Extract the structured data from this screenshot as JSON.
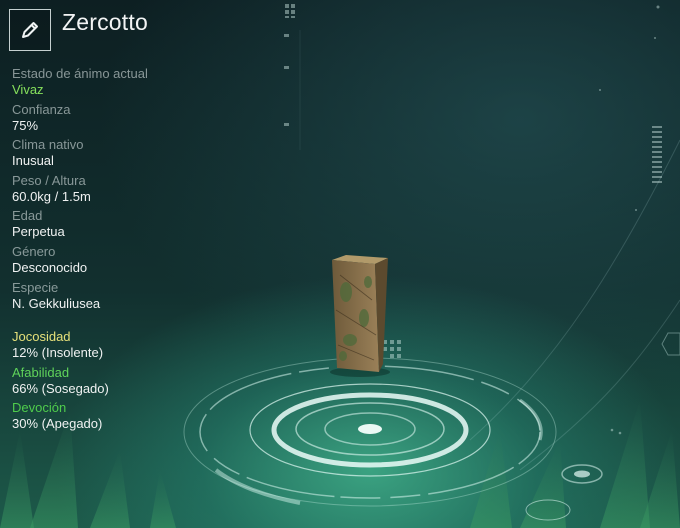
{
  "creature": {
    "name": "Zercotto",
    "stats": [
      {
        "label": "Estado de ánimo actual",
        "value": "Vivaz"
      },
      {
        "label": "Confianza",
        "value": "75%"
      },
      {
        "label": "Clima nativo",
        "value": "Inusual"
      },
      {
        "label": "Peso / Altura",
        "value": "60.0kg / 1.5m"
      },
      {
        "label": "Edad",
        "value": "Perpetua"
      },
      {
        "label": "Género",
        "value": "Desconocido"
      },
      {
        "label": "Especie",
        "value": "N. Gekkuliusea"
      }
    ],
    "traits": [
      {
        "label": "Jocosidad",
        "value": "12% (Insolente)",
        "color": "#e6e07a"
      },
      {
        "label": "Afabilidad",
        "value": "66% (Sosegado)",
        "color": "#5fd35a"
      },
      {
        "label": "Devoción",
        "value": "30% (Apegado)",
        "color": "#4fcc4c"
      }
    ]
  },
  "icons": {
    "edit": "pencil-icon"
  },
  "colors": {
    "mood_value": "#86e05c",
    "ring": "#d8f4ec",
    "accent_teal": "#5fd0b0"
  }
}
